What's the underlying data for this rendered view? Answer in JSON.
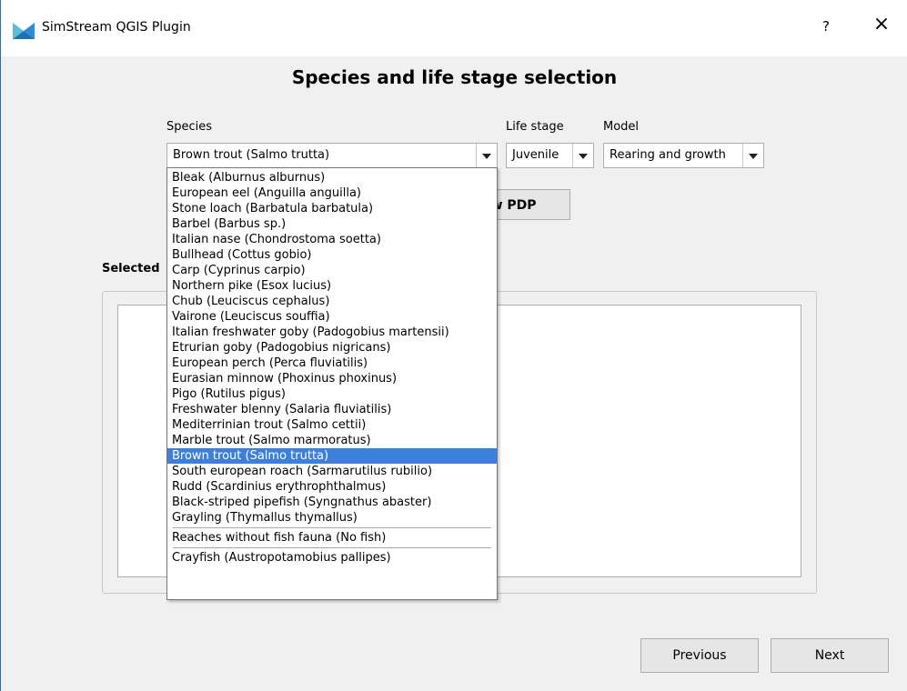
{
  "window": {
    "title": "SimStream QGIS Plugin",
    "help_label": "?",
    "close_label": "×"
  },
  "heading": "Species and life stage selection",
  "labels": {
    "species": "Species",
    "life_stage": "Life stage",
    "model": "Model",
    "selected": "Selected"
  },
  "species_combo": {
    "value": "Brown trout (Salmo trutta)"
  },
  "life_stage_combo": {
    "value": "Juvenile"
  },
  "model_combo": {
    "value": "Rearing and growth"
  },
  "pdp_button": {
    "label": "Show PDP",
    "visible_label": "ow PDP"
  },
  "dropdown": {
    "group1": [
      "Bleak (Alburnus alburnus)",
      "European eel (Anguilla anguilla)",
      "Stone loach (Barbatula barbatula)",
      "Barbel (Barbus sp.)",
      "Italian nase (Chondrostoma soetta)",
      "Bullhead (Cottus gobio)",
      "Carp (Cyprinus carpio)",
      "Northern pike (Esox lucius)",
      "Chub (Leuciscus cephalus)",
      "Vairone (Leuciscus souffia)",
      "Italian freshwater goby (Padogobius martensii)",
      "Etrurian goby (Padogobius nigricans)",
      "European perch (Perca fluviatilis)",
      "Eurasian minnow (Phoxinus phoxinus)",
      "Pigo (Rutilus pigus)",
      "Freshwater blenny (Salaria fluviatilis)",
      "Mediterrinian trout (Salmo cettii)",
      "Marble trout (Salmo marmoratus)",
      "Brown trout (Salmo trutta)",
      "South european roach (Sarmarutilus rubilio)",
      "Rudd (Scardinius erythrophthalmus)",
      "Black-striped pipefish (Syngnathus abaster)",
      "Grayling (Thymallus thymallus)"
    ],
    "selected_index": 18,
    "group2": [
      "Reaches without fish fauna (No fish)"
    ],
    "group3": [
      "Crayfish (Austropotamobius pallipes)"
    ]
  },
  "buttons": {
    "previous": "Previous",
    "next": "Next"
  },
  "colors": {
    "selection": "#3d7fd9",
    "icon_blue": "#2e8bd8",
    "icon_teal": "#5bbfd0"
  }
}
